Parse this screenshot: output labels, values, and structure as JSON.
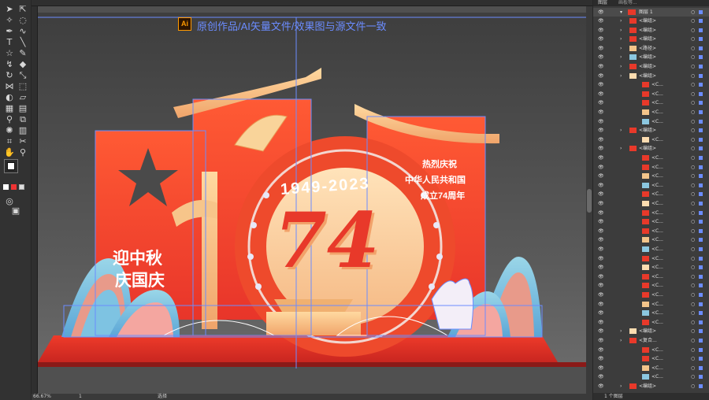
{
  "banner": {
    "ai_label": "Ai",
    "text": "原创作品/AI矢量文件/效果图与源文件一致"
  },
  "artwork": {
    "vertical_text_1": "迎中秋",
    "vertical_text_2": "庆国庆",
    "year_text": "1949-2023",
    "big_number": "74",
    "right_text_1": "热烈庆祝",
    "right_text_2": "中华人民共和国",
    "right_text_3": "成立74周年"
  },
  "status": {
    "zoom": "66.67%",
    "artboard": "1",
    "tool": "选择"
  },
  "layers_panel": {
    "tab1": "图层",
    "tab2": "画板等...",
    "top_layer": "图层 1",
    "items": [
      "<编组>",
      "<编组>",
      "<编组>",
      "<路径>",
      "<编组>",
      "<编组>",
      "<编组>",
      "<C...",
      "<C...",
      "<C...",
      "<C...",
      "<C...",
      "<编组>",
      "<C...",
      "<编组>",
      "<C...",
      "<C...",
      "<C...",
      "<C...",
      "<C...",
      "<C...",
      "<C...",
      "<C...",
      "<C...",
      "<C...",
      "<C...",
      "<C...",
      "<C...",
      "<C...",
      "<C...",
      "<C...",
      "<C...",
      "<C...",
      "<C...",
      "<编组>",
      "<复合...",
      "<C...",
      "<C...",
      "<C...",
      "<C...",
      "<编组>"
    ],
    "footer": "1 个图层"
  },
  "colors": {
    "accent": "#6b8cff",
    "red": "#e8432d",
    "gold": "#f6c58a"
  }
}
